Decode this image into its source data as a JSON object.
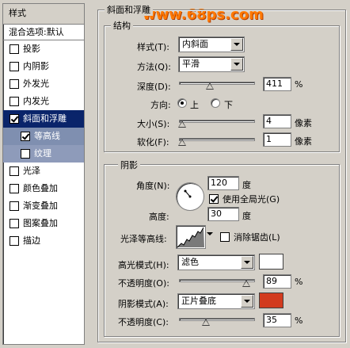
{
  "style_list": {
    "header": "样式",
    "blend_options": "混合选项:默认",
    "items": [
      {
        "label": "投影",
        "checked": false
      },
      {
        "label": "内阴影",
        "checked": false
      },
      {
        "label": "外发光",
        "checked": false
      },
      {
        "label": "内发光",
        "checked": false
      },
      {
        "label": "斜面和浮雕",
        "checked": true
      },
      {
        "label": "等高线",
        "checked": true
      },
      {
        "label": "纹理",
        "checked": false
      },
      {
        "label": "光泽",
        "checked": false
      },
      {
        "label": "颜色叠加",
        "checked": false
      },
      {
        "label": "渐变叠加",
        "checked": false
      },
      {
        "label": "图案叠加",
        "checked": false
      },
      {
        "label": "描边",
        "checked": false
      }
    ]
  },
  "watermark": "www.68ps.com",
  "bevel": {
    "title": "斜面和浮雕",
    "structure": {
      "title": "结构",
      "style_label": "样式(T):",
      "style_value": "内斜面",
      "technique_label": "方法(Q):",
      "technique_value": "平滑",
      "depth_label": "深度(D):",
      "depth_value": "411",
      "depth_unit": "%",
      "depth_slider": 0.4,
      "direction_label": "方向:",
      "direction_up": "上",
      "direction_down": "下",
      "size_label": "大小(S):",
      "size_value": "4",
      "size_unit": "像素",
      "size_slider": 0.03,
      "soften_label": "软化(F):",
      "soften_value": "1",
      "soften_unit": "像素",
      "soften_slider": 0.03
    },
    "shading": {
      "title": "阴影",
      "angle_label": "角度(N):",
      "angle_value": "120",
      "angle_unit": "度",
      "global_light_label": "使用全局光(G)",
      "altitude_label": "高度:",
      "altitude_value": "30",
      "altitude_unit": "度",
      "gloss_label": "光泽等高线:",
      "anti_alias_label": "消除锯齿(L)",
      "highlight_mode_label": "高光模式(H):",
      "highlight_mode_value": "滤色",
      "highlight_color": "#ffffff",
      "highlight_opacity_label": "不透明度(O):",
      "highlight_opacity_value": "89",
      "highlight_opacity_unit": "%",
      "highlight_opacity_slider": 0.89,
      "shadow_mode_label": "阴影模式(A):",
      "shadow_mode_value": "正片叠底",
      "shadow_color": "#d23b1e",
      "shadow_opacity_label": "不透明度(C):",
      "shadow_opacity_value": "35",
      "shadow_opacity_unit": "%",
      "shadow_opacity_slider": 0.35
    }
  }
}
